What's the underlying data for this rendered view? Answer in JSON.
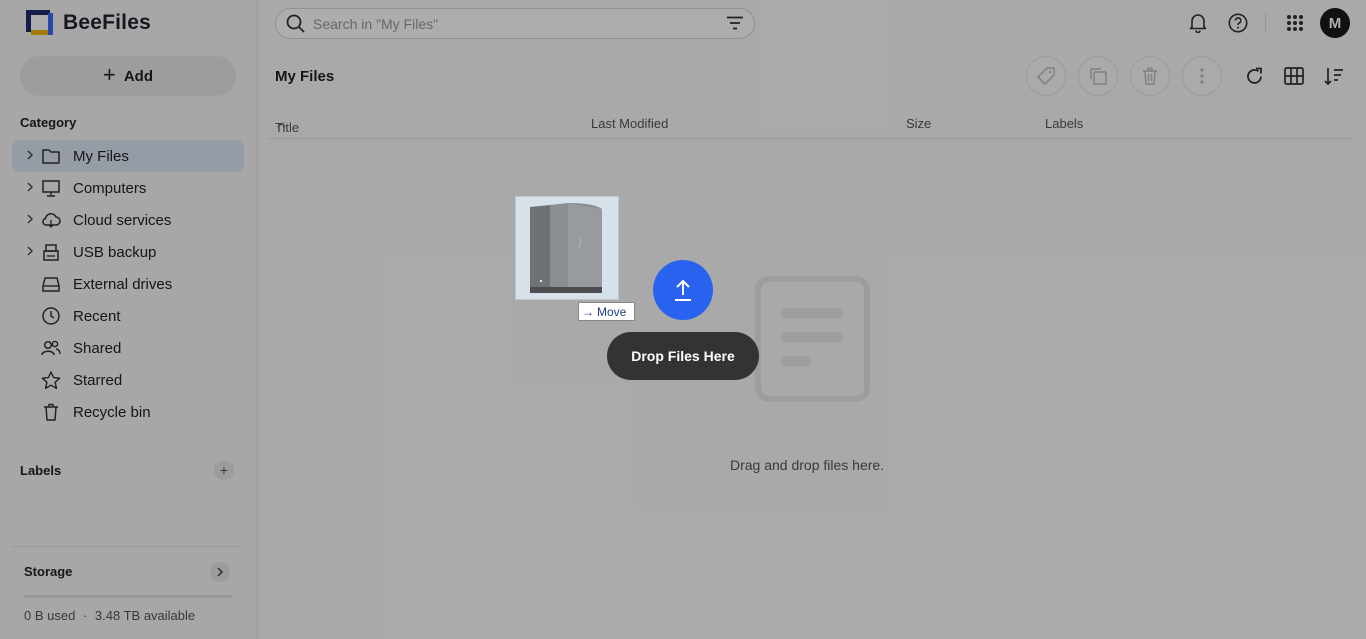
{
  "app": {
    "name": "BeeFiles"
  },
  "sidebar": {
    "add_label": "Add",
    "category_title": "Category",
    "categories": [
      {
        "label": "My Files",
        "icon": "folder-icon",
        "expandable": true,
        "active": true
      },
      {
        "label": "Computers",
        "icon": "monitor-icon",
        "expandable": true,
        "active": false
      },
      {
        "label": "Cloud services",
        "icon": "cloud-icon",
        "expandable": true,
        "active": false
      },
      {
        "label": "USB backup",
        "icon": "usb-drive-icon",
        "expandable": true,
        "active": false
      },
      {
        "label": "External drives",
        "icon": "hard-drive-icon",
        "expandable": false,
        "active": false
      },
      {
        "label": "Recent",
        "icon": "clock-icon",
        "expandable": false,
        "active": false
      },
      {
        "label": "Shared",
        "icon": "people-icon",
        "expandable": false,
        "active": false
      },
      {
        "label": "Starred",
        "icon": "star-icon",
        "expandable": false,
        "active": false
      },
      {
        "label": "Recycle bin",
        "icon": "trash-icon",
        "expandable": false,
        "active": false
      }
    ],
    "labels_title": "Labels",
    "storage": {
      "title": "Storage",
      "used": "0 B used",
      "separator": "·",
      "available": "3.48 TB available",
      "used_fraction": 0
    }
  },
  "search": {
    "placeholder": "Search in \"My Files\"",
    "value": ""
  },
  "header": {
    "avatar_initial": "M"
  },
  "main": {
    "title": "My Files",
    "columns": {
      "title": "Title",
      "sort_indicator": "^",
      "last_modified": "Last Modified",
      "size": "Size",
      "labels": "Labels"
    },
    "empty_text": "Drag and drop files here."
  },
  "drop_overlay": {
    "drop_label": "Drop Files Here",
    "move_label": "Move",
    "move_arrow": "→"
  },
  "colors": {
    "accent": "#2a62f0",
    "active_bg": "#dce6f3",
    "pill_bg": "#333333"
  }
}
